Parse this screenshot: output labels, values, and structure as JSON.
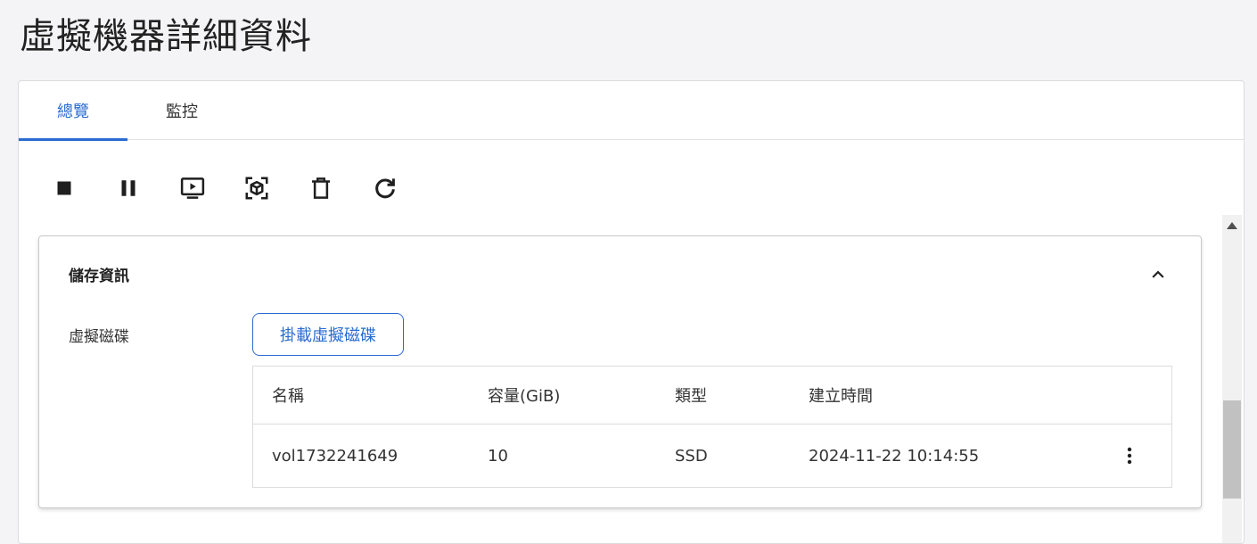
{
  "page": {
    "title": "虛擬機器詳細資料"
  },
  "tabs": [
    {
      "label": "總覽",
      "active": true
    },
    {
      "label": "監控",
      "active": false
    }
  ],
  "toolbar": {
    "icons": [
      "stop-icon",
      "pause-icon",
      "console-icon",
      "snapshot-icon",
      "delete-icon",
      "refresh-icon"
    ]
  },
  "storage": {
    "title": "儲存資訊",
    "disk_label": "虛擬磁碟",
    "mount_button": "掛載虛擬磁碟",
    "table": {
      "headers": [
        "名稱",
        "容量(GiB)",
        "類型",
        "建立時間"
      ],
      "rows": [
        {
          "name": "vol1732241649",
          "capacity": "10",
          "type": "SSD",
          "created": "2024-11-22 10:14:55"
        }
      ]
    }
  },
  "colors": {
    "accent": "#2a6bd1",
    "background": "#f4f4f6"
  }
}
